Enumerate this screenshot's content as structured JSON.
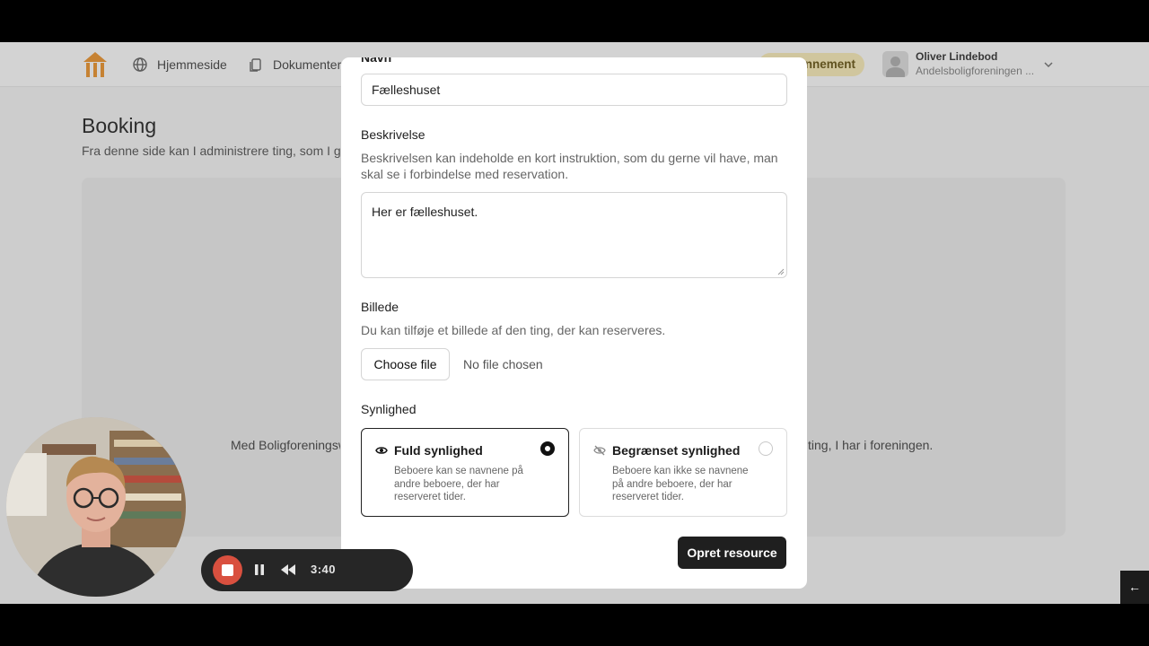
{
  "header": {
    "nav": [
      {
        "label": "Hjemmeside",
        "icon": "globe-icon"
      },
      {
        "label": "Dokumenter",
        "icon": "documents-icon"
      }
    ],
    "subscription_label": "onnement",
    "user": {
      "name": "Oliver Lindebod",
      "org": "Andelsboligforeningen ..."
    }
  },
  "page": {
    "title": "Booking",
    "subtitle": "Fra denne side kan I administrere ting, som I gern",
    "panel_text_left": "Med Boligforeningsw",
    "panel_text_right": "ting, I har i foreningen."
  },
  "modal": {
    "name_label_cut": "Navn",
    "name_value": "Fælleshuset",
    "description_label": "Beskrivelse",
    "description_help": "Beskrivelsen kan indeholde en kort instruktion, som du gerne vil have, man skal se i forbindelse med reservation.",
    "description_value": "Her er fælleshuset.",
    "image_label": "Billede",
    "image_help": "Du kan tilføje et billede af den ting, der kan reserveres.",
    "choose_file_label": "Choose file",
    "file_status": "No file chosen",
    "visibility_label": "Synlighed",
    "options": [
      {
        "title": "Fuld synlighed",
        "desc": "Beboere kan se navnene på andre beboere, der har reserveret tider.",
        "selected": true,
        "icon": "eye-icon"
      },
      {
        "title": "Begrænset synlighed",
        "desc": "Beboere kan ikke se navnene på andre beboere, der har reserveret tider.",
        "selected": false,
        "icon": "eye-off-icon"
      }
    ],
    "submit_label": "Opret resource"
  },
  "recorder": {
    "time": "3:40"
  },
  "side_button": "←",
  "colors": {
    "accent": "#1f1f1f",
    "brand": "#e8891c",
    "recorder_stop": "#d9503f",
    "subscription_pill": "#f6e8b1"
  }
}
